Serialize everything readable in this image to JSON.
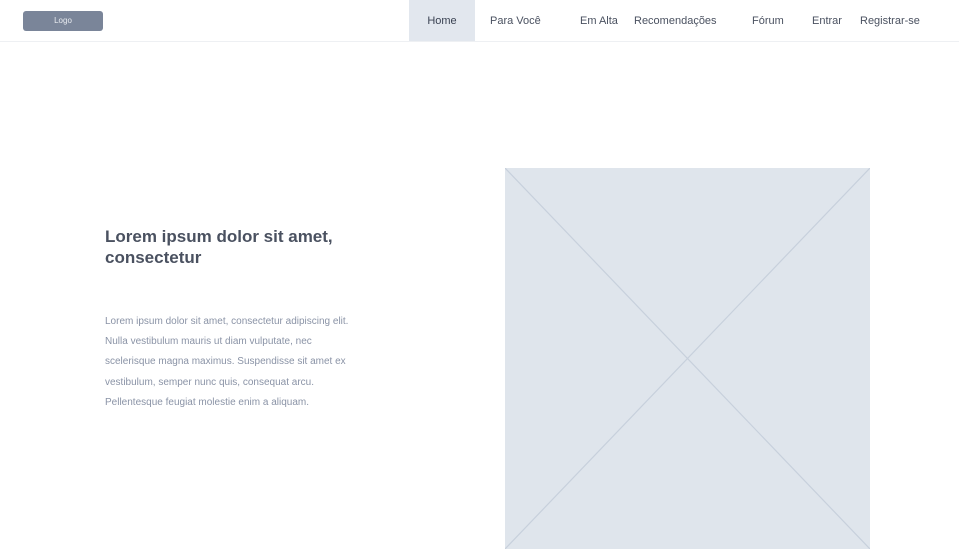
{
  "header": {
    "logo_text": "Logo",
    "nav": [
      {
        "label": "Home",
        "active": true
      },
      {
        "label": "Para Você"
      },
      {
        "label": "Em Alta"
      },
      {
        "label": "Recomendações"
      },
      {
        "label": "Fórum"
      },
      {
        "label": "Entrar"
      },
      {
        "label": "Registrar-se"
      }
    ]
  },
  "hero": {
    "title": "Lorem ipsum dolor sit amet, consectetur",
    "body": "Lorem ipsum dolor sit amet, consectetur adipiscing elit. Nulla vestibulum mauris ut diam vulputate, nec scelerisque magna maximus. Suspendisse sit amet ex vestibulum, semper nunc quis, consequat arcu. Pellentesque feugiat molestie enim a aliquam.",
    "image_icon": "image-placeholder-icon"
  },
  "colors": {
    "logo_bg": "#7a8599",
    "active_nav_bg": "#e2e7ee",
    "placeholder_bg": "#dfe5ec",
    "placeholder_lines": "#c7d0dc",
    "heading_text": "#4a5160",
    "body_text": "#8a93a6"
  }
}
